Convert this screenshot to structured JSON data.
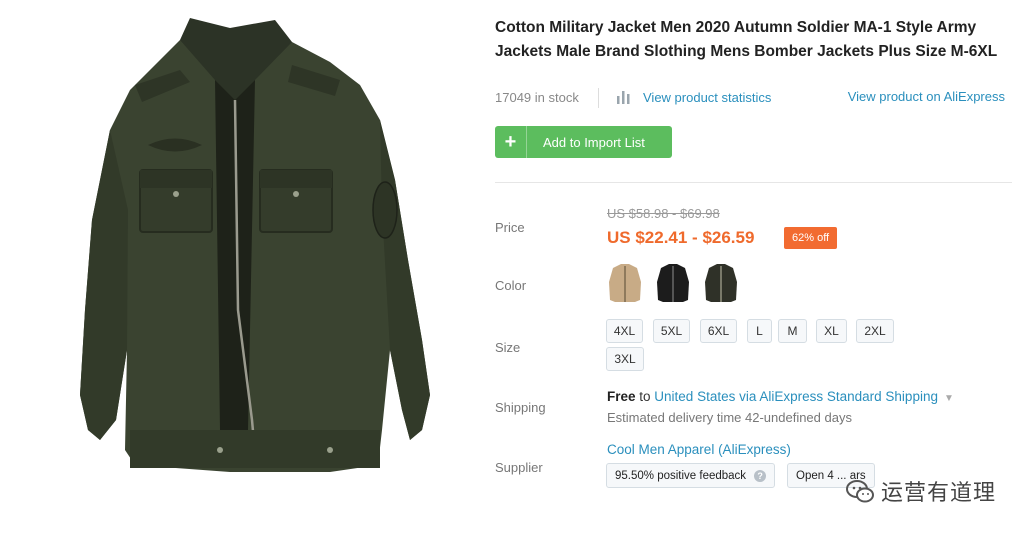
{
  "product": {
    "title": "Cotton Military Jacket Men 2020 Autumn Soldier MA-1 Style Army Jackets Male Brand Slothing Mens Bomber Jackets Plus Size M-6XL",
    "image_alt": "olive green military jacket"
  },
  "meta": {
    "stock": "17049 in stock",
    "stats_icon": "bar-chart-icon",
    "stats_link": "View product statistics",
    "aliexpress_link": "View product on AliExpress"
  },
  "actions": {
    "add_icon": "plus-icon",
    "add_label": "Add to Import List"
  },
  "price": {
    "label": "Price",
    "original": "US $58.98 - $69.98",
    "current": "US $22.41 - $26.59",
    "discount": "62% off"
  },
  "color": {
    "label": "Color",
    "options": [
      {
        "name": "khaki",
        "hex": "#c8ab86"
      },
      {
        "name": "black",
        "hex": "#1c1c1c"
      },
      {
        "name": "army green",
        "hex": "#2f3128"
      }
    ]
  },
  "size": {
    "label": "Size",
    "options": [
      "4XL",
      "5XL",
      "6XL",
      "L",
      "M",
      "XL",
      "2XL",
      "3XL"
    ]
  },
  "shipping": {
    "label": "Shipping",
    "free": "Free",
    "to": " to ",
    "destination": "United States via AliExpress Standard Shipping",
    "chevron_icon": "chevron-down-icon",
    "estimate": "Estimated delivery time 42-undefined days"
  },
  "supplier": {
    "label": "Supplier",
    "name": "Cool Men Apparel (AliExpress)",
    "feedback": "95.50% positive feedback",
    "info_icon": "question-icon",
    "open_badge": "Open 4 ... ars"
  },
  "watermark": {
    "logo_icon": "wechat-icon",
    "text": "运营有道理"
  },
  "colors": {
    "accent_green": "#5cbd5e",
    "link_blue": "#2a8fbd",
    "price_orange": "#ef6a2c",
    "jacket_olive": "#3a4330"
  }
}
